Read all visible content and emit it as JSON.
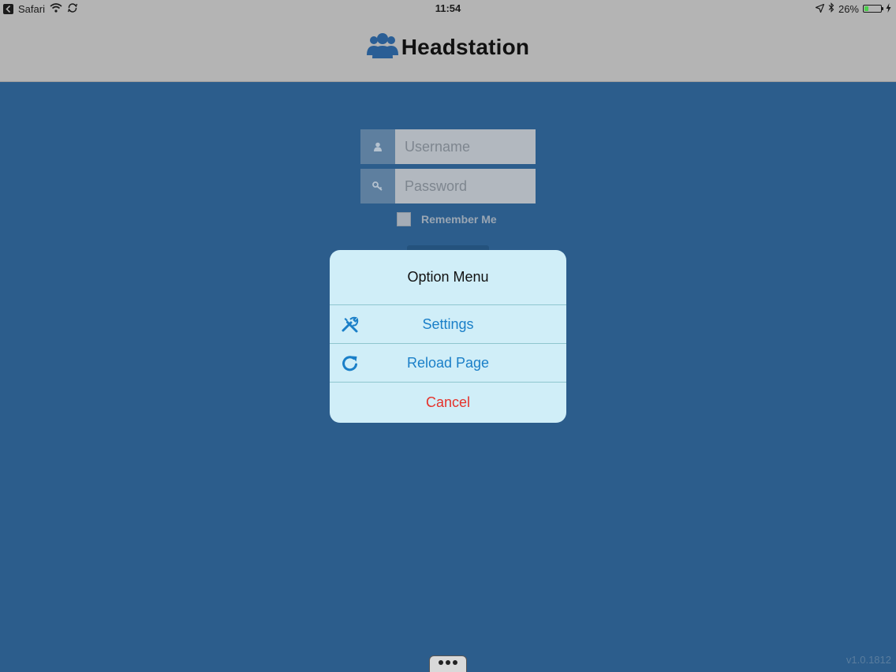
{
  "status_bar": {
    "app": "Safari",
    "time": "11:54",
    "battery": "26%",
    "battery_level": 0.26
  },
  "header": {
    "brand_title": "Headstation",
    "brand_icon": "users-icon"
  },
  "login": {
    "username_placeholder": "Username",
    "password_placeholder": "Password",
    "remember_label": "Remember Me"
  },
  "option_menu": {
    "title": "Option Menu",
    "items": [
      {
        "label": "Settings",
        "icon": "tools-icon"
      },
      {
        "label": "Reload Page",
        "icon": "reload-icon"
      }
    ],
    "cancel_label": "Cancel"
  },
  "footer": {
    "version": "v1.0.1812"
  },
  "colors": {
    "background": "#2c5d8c",
    "header": "#b4b4b4",
    "menu_bg": "#d0eef8",
    "menu_link": "#1a7fc8",
    "cancel": "#e5322b"
  }
}
